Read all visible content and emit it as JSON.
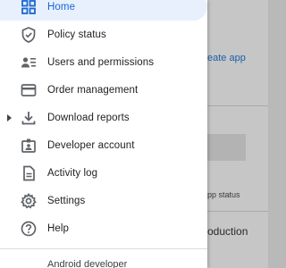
{
  "background": {
    "create_app_text": "eate app",
    "app_status_text": "pp status",
    "production_text": "roduction"
  },
  "drawer": {
    "items": [
      {
        "label": "Home",
        "icon": "dashboard-icon"
      },
      {
        "label": "Policy status",
        "icon": "shield-icon"
      },
      {
        "label": "Users and permissions",
        "icon": "users-list-icon"
      },
      {
        "label": "Order management",
        "icon": "credit-card-icon"
      },
      {
        "label": "Download reports",
        "icon": "download-icon"
      },
      {
        "label": "Developer account",
        "icon": "badge-icon"
      },
      {
        "label": "Activity log",
        "icon": "document-icon"
      },
      {
        "label": "Settings",
        "icon": "gear-icon"
      },
      {
        "label": "Help",
        "icon": "help-icon"
      }
    ],
    "footer_text": "Android developer"
  },
  "colors": {
    "accent": "#1967d2",
    "active_background": "#e8f0fe",
    "icon": "#5f6368"
  }
}
